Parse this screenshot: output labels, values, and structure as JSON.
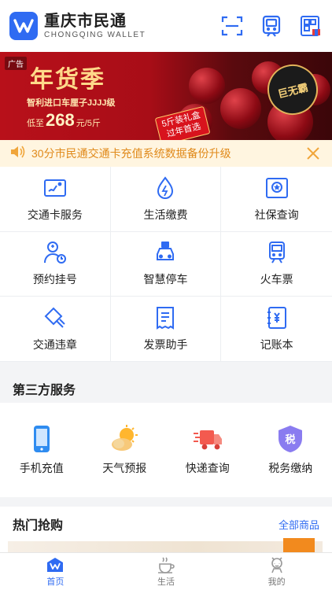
{
  "header": {
    "brand_cn": "重庆市民通",
    "brand_en": "CHONGQING WALLET"
  },
  "banner": {
    "ad_tag": "广告",
    "title": "年货季",
    "sub1": "智利进口车厘子JJJJ级",
    "price_prefix": "低至",
    "price": "268",
    "price_suffix": "元/5斤",
    "tag_line1": "5斤装礼盒",
    "tag_line2": "过年首选",
    "badge": "巨无霸"
  },
  "notice": {
    "text": "30分市民通交通卡充值系统数据备份升级"
  },
  "services": [
    {
      "label": "交通卡服务",
      "icon": "transit-card-icon"
    },
    {
      "label": "生活缴费",
      "icon": "utility-bill-icon"
    },
    {
      "label": "社保查询",
      "icon": "social-security-icon"
    },
    {
      "label": "预约挂号",
      "icon": "doctor-appointment-icon"
    },
    {
      "label": "智慧停车",
      "icon": "parking-car-icon"
    },
    {
      "label": "火车票",
      "icon": "train-ticket-icon"
    },
    {
      "label": "交通违章",
      "icon": "traffic-violation-icon"
    },
    {
      "label": "发票助手",
      "icon": "invoice-icon"
    },
    {
      "label": "记账本",
      "icon": "ledger-book-icon"
    }
  ],
  "third_party": {
    "title": "第三方服务",
    "items": [
      {
        "label": "手机充值",
        "icon": "phone-recharge-icon"
      },
      {
        "label": "天气预报",
        "icon": "weather-icon"
      },
      {
        "label": "快递查询",
        "icon": "delivery-truck-icon"
      },
      {
        "label": "税务缴纳",
        "icon": "tax-icon"
      }
    ]
  },
  "hot": {
    "title": "热门抢购",
    "more": "全部商品"
  },
  "tabs": [
    {
      "label": "首页",
      "active": true
    },
    {
      "label": "生活",
      "active": false
    },
    {
      "label": "我的",
      "active": false
    }
  ],
  "colors": {
    "brand": "#2f6bf2",
    "notice_text": "#e08a1b",
    "notice_bg": "#fff5e0"
  }
}
